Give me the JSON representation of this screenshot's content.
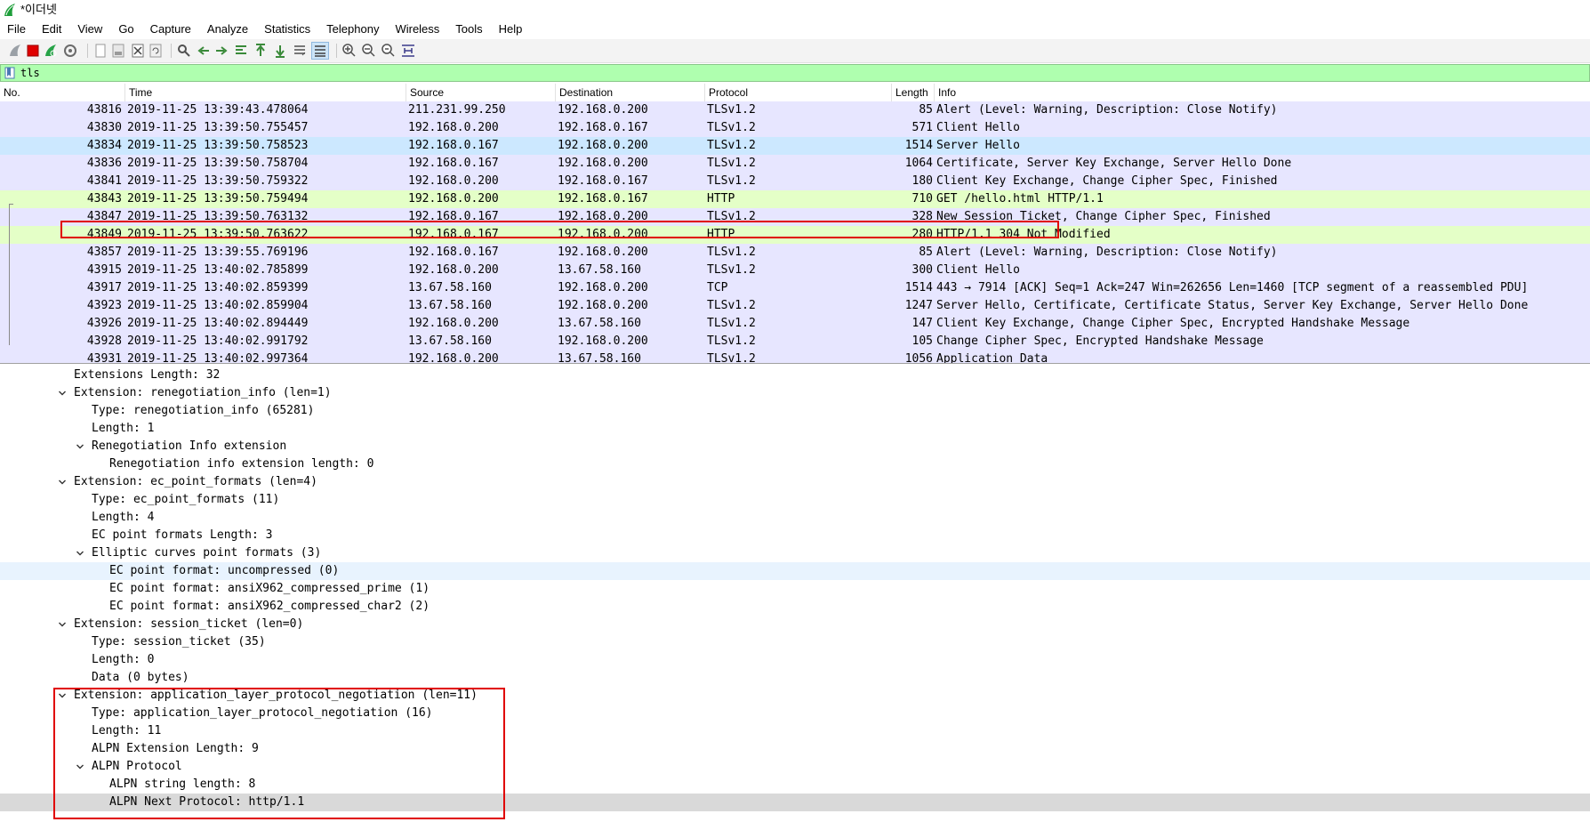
{
  "window": {
    "title": "*이더넷",
    "icons": {
      "app": "wireshark-fin-icon"
    }
  },
  "menu": [
    "File",
    "Edit",
    "View",
    "Go",
    "Capture",
    "Analyze",
    "Statistics",
    "Telephony",
    "Wireless",
    "Tools",
    "Help"
  ],
  "toolbar": {
    "buttons": [
      "start-capture-icon",
      "stop-capture-icon",
      "restart-capture-icon",
      "capture-options-icon",
      "open-file-icon",
      "save-file-icon",
      "close-file-icon",
      "reload-file-icon",
      "find-packet-icon",
      "go-back-icon",
      "go-forward-icon",
      "go-to-packet-icon",
      "first-packet-icon",
      "last-packet-icon",
      "auto-scroll-icon",
      "colorize-icon",
      "zoom-in-icon",
      "zoom-out-icon",
      "normal-size-icon",
      "resize-columns-icon"
    ]
  },
  "filter": {
    "value": "tls",
    "background": "#afffaf",
    "icons": {
      "bookmark": "filter-bookmark-icon"
    }
  },
  "packet_list": {
    "columns": [
      "No.",
      "Time",
      "Source",
      "Destination",
      "Protocol",
      "Length",
      "Info"
    ],
    "rows": [
      {
        "no": "43816",
        "time": "2019-11-25 13:39:43.478064",
        "src": "211.231.99.250",
        "dst": "192.168.0.200",
        "proto": "TLSv1.2",
        "len": "85",
        "info": "Alert (Level: Warning, Description: Close Notify)",
        "kind": "tls"
      },
      {
        "no": "43830",
        "time": "2019-11-25 13:39:50.755457",
        "src": "192.168.0.200",
        "dst": "192.168.0.167",
        "proto": "TLSv1.2",
        "len": "571",
        "info": "Client Hello",
        "kind": "tls"
      },
      {
        "no": "43834",
        "time": "2019-11-25 13:39:50.758523",
        "src": "192.168.0.167",
        "dst": "192.168.0.200",
        "proto": "TLSv1.2",
        "len": "1514",
        "info": "Server Hello",
        "kind": "selected"
      },
      {
        "no": "43836",
        "time": "2019-11-25 13:39:50.758704",
        "src": "192.168.0.167",
        "dst": "192.168.0.200",
        "proto": "TLSv1.2",
        "len": "1064",
        "info": "Certificate, Server Key Exchange, Server Hello Done",
        "kind": "tls"
      },
      {
        "no": "43841",
        "time": "2019-11-25 13:39:50.759322",
        "src": "192.168.0.200",
        "dst": "192.168.0.167",
        "proto": "TLSv1.2",
        "len": "180",
        "info": "Client Key Exchange, Change Cipher Spec, Finished",
        "kind": "tls"
      },
      {
        "no": "43843",
        "time": "2019-11-25 13:39:50.759494",
        "src": "192.168.0.200",
        "dst": "192.168.0.167",
        "proto": "HTTP",
        "len": "710",
        "info": "GET /hello.html HTTP/1.1",
        "kind": "http"
      },
      {
        "no": "43847",
        "time": "2019-11-25 13:39:50.763132",
        "src": "192.168.0.167",
        "dst": "192.168.0.200",
        "proto": "TLSv1.2",
        "len": "328",
        "info": "New Session Ticket, Change Cipher Spec, Finished",
        "kind": "tls"
      },
      {
        "no": "43849",
        "time": "2019-11-25 13:39:50.763622",
        "src": "192.168.0.167",
        "dst": "192.168.0.200",
        "proto": "HTTP",
        "len": "280",
        "info": "HTTP/1.1 304 Not Modified",
        "kind": "http"
      },
      {
        "no": "43857",
        "time": "2019-11-25 13:39:55.769196",
        "src": "192.168.0.167",
        "dst": "192.168.0.200",
        "proto": "TLSv1.2",
        "len": "85",
        "info": "Alert (Level: Warning, Description: Close Notify)",
        "kind": "tls"
      },
      {
        "no": "43915",
        "time": "2019-11-25 13:40:02.785899",
        "src": "192.168.0.200",
        "dst": "13.67.58.160",
        "proto": "TLSv1.2",
        "len": "300",
        "info": "Client Hello",
        "kind": "tls"
      },
      {
        "no": "43917",
        "time": "2019-11-25 13:40:02.859399",
        "src": "13.67.58.160",
        "dst": "192.168.0.200",
        "proto": "TCP",
        "len": "1514",
        "info": "443 → 7914 [ACK] Seq=1 Ack=247 Win=262656 Len=1460 [TCP segment of a reassembled PDU]",
        "kind": "tcp"
      },
      {
        "no": "43923",
        "time": "2019-11-25 13:40:02.859904",
        "src": "13.67.58.160",
        "dst": "192.168.0.200",
        "proto": "TLSv1.2",
        "len": "1247",
        "info": "Server Hello, Certificate, Certificate Status, Server Key Exchange, Server Hello Done",
        "kind": "tls"
      },
      {
        "no": "43926",
        "time": "2019-11-25 13:40:02.894449",
        "src": "192.168.0.200",
        "dst": "13.67.58.160",
        "proto": "TLSv1.2",
        "len": "147",
        "info": "Client Key Exchange, Change Cipher Spec, Encrypted Handshake Message",
        "kind": "tls"
      },
      {
        "no": "43928",
        "time": "2019-11-25 13:40:02.991792",
        "src": "13.67.58.160",
        "dst": "192.168.0.200",
        "proto": "TLSv1.2",
        "len": "105",
        "info": "Change Cipher Spec, Encrypted Handshake Message",
        "kind": "tls"
      },
      {
        "no": "43931",
        "time": "2019-11-25 13:40:02.997364",
        "src": "192.168.0.200",
        "dst": "13.67.58.160",
        "proto": "TLSv1.2",
        "len": "1056",
        "info": "Application Data",
        "kind": "tls"
      }
    ]
  },
  "details": {
    "lines": [
      {
        "text": "Extensions Length: 32",
        "level": 2,
        "toggle": "none",
        "state": ""
      },
      {
        "text": "Extension: renegotiation_info (len=1)",
        "level": 2,
        "toggle": "open",
        "state": ""
      },
      {
        "text": "Type: renegotiation_info (65281)",
        "level": 3,
        "toggle": "none",
        "state": ""
      },
      {
        "text": "Length: 1",
        "level": 3,
        "toggle": "none",
        "state": ""
      },
      {
        "text": "Renegotiation Info extension",
        "level": 3,
        "toggle": "open",
        "state": ""
      },
      {
        "text": "Renegotiation info extension length: 0",
        "level": 4,
        "toggle": "none",
        "state": ""
      },
      {
        "text": "Extension: ec_point_formats (len=4)",
        "level": 2,
        "toggle": "open",
        "state": ""
      },
      {
        "text": "Type: ec_point_formats (11)",
        "level": 3,
        "toggle": "none",
        "state": ""
      },
      {
        "text": "Length: 4",
        "level": 3,
        "toggle": "none",
        "state": ""
      },
      {
        "text": "EC point formats Length: 3",
        "level": 3,
        "toggle": "none",
        "state": ""
      },
      {
        "text": "Elliptic curves point formats (3)",
        "level": 3,
        "toggle": "open",
        "state": ""
      },
      {
        "text": "EC point format: uncompressed (0)",
        "level": 4,
        "toggle": "none",
        "state": "hl"
      },
      {
        "text": "EC point format: ansiX962_compressed_prime (1)",
        "level": 4,
        "toggle": "none",
        "state": ""
      },
      {
        "text": "EC point format: ansiX962_compressed_char2 (2)",
        "level": 4,
        "toggle": "none",
        "state": ""
      },
      {
        "text": "Extension: session_ticket (len=0)",
        "level": 2,
        "toggle": "open",
        "state": ""
      },
      {
        "text": "Type: session_ticket (35)",
        "level": 3,
        "toggle": "none",
        "state": ""
      },
      {
        "text": "Length: 0",
        "level": 3,
        "toggle": "none",
        "state": ""
      },
      {
        "text": "Data (0 bytes)",
        "level": 3,
        "toggle": "none",
        "state": ""
      },
      {
        "text": "Extension: application_layer_protocol_negotiation (len=11)",
        "level": 2,
        "toggle": "open",
        "state": ""
      },
      {
        "text": "Type: application_layer_protocol_negotiation (16)",
        "level": 3,
        "toggle": "none",
        "state": ""
      },
      {
        "text": "Length: 11",
        "level": 3,
        "toggle": "none",
        "state": ""
      },
      {
        "text": "ALPN Extension Length: 9",
        "level": 3,
        "toggle": "none",
        "state": ""
      },
      {
        "text": "ALPN Protocol",
        "level": 3,
        "toggle": "open",
        "state": ""
      },
      {
        "text": "ALPN string length: 8",
        "level": 4,
        "toggle": "none",
        "state": ""
      },
      {
        "text": "ALPN Next Protocol: http/1.1",
        "level": 4,
        "toggle": "none",
        "state": "sel"
      }
    ],
    "icons": {
      "expander": "chevron-down-icon"
    }
  },
  "colors": {
    "tls_row": "#e7e6ff",
    "http_row": "#e4ffc7",
    "selected_row": "#cce8ff",
    "annotation": "#e00000"
  }
}
